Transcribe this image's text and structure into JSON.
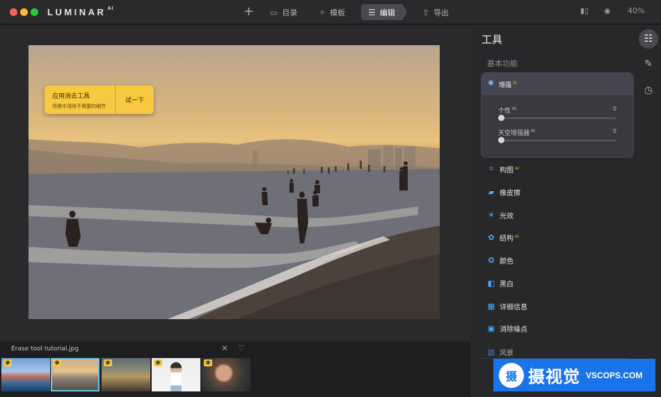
{
  "app": {
    "logo": "LUMINAR",
    "logo_suffix": "AI"
  },
  "toolbar": {
    "add_icon": "plus-icon",
    "catalog": "目录",
    "templates": "模板",
    "edit": "编辑",
    "export": "导出",
    "zoom": "40%"
  },
  "tooltip": {
    "title": "应用消去工具",
    "subtitle": "场景中清除不需要的细节",
    "button": "试一下"
  },
  "filmstrip": {
    "filename": "Erase tool tutorial.jpg",
    "selected_index": 1
  },
  "panel": {
    "title": "工具",
    "section": "基本功能",
    "enhance": {
      "label": "增强",
      "badge": "AI",
      "sliders": [
        {
          "label": "个性",
          "badge": "AI",
          "value": "0"
        },
        {
          "label": "天空增强器",
          "badge": "AI",
          "value": "0"
        }
      ]
    },
    "tools": [
      {
        "label": "构图",
        "badge": "AI",
        "icon": "crop-icon"
      },
      {
        "label": "橡皮擦",
        "badge": "",
        "icon": "eraser-icon"
      },
      {
        "label": "光效",
        "badge": "",
        "icon": "sun-icon"
      },
      {
        "label": "结构",
        "badge": "AI",
        "icon": "structure-icon"
      },
      {
        "label": "颜色",
        "badge": "",
        "icon": "color-icon"
      },
      {
        "label": "黑白",
        "badge": "",
        "icon": "bw-icon"
      },
      {
        "label": "详细信息",
        "badge": "",
        "icon": "details-icon"
      },
      {
        "label": "消除噪点",
        "badge": "",
        "icon": "denoise-icon"
      },
      {
        "label": "风景",
        "badge": "",
        "icon": "landscape-icon"
      }
    ]
  },
  "watermark": {
    "cn": "摄视觉",
    "en": "VSCOPS.COM",
    "mark": "摄"
  },
  "colors": {
    "accent": "#4aa8ff",
    "ai_badge": "#f0a23b",
    "tooltip": "#f8c841",
    "watermark": "#1a73e8"
  }
}
